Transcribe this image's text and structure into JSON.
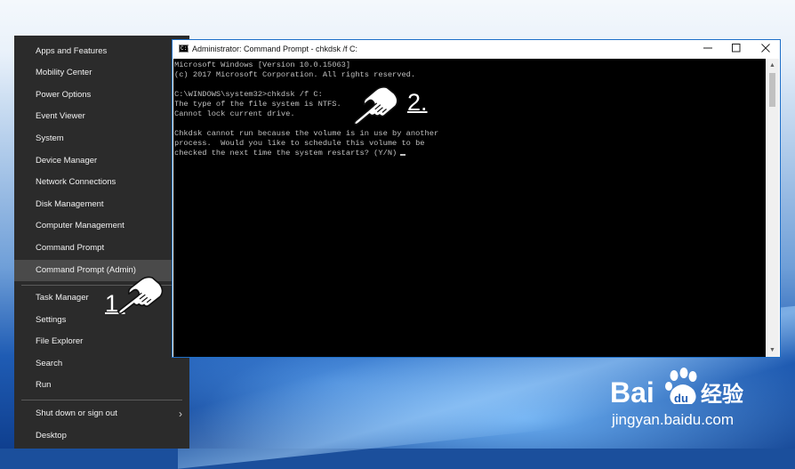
{
  "start_menu": {
    "items": [
      {
        "label": "Apps and Features"
      },
      {
        "label": "Mobility Center"
      },
      {
        "label": "Power Options"
      },
      {
        "label": "Event Viewer"
      },
      {
        "label": "System"
      },
      {
        "label": "Device Manager"
      },
      {
        "label": "Network Connections"
      },
      {
        "label": "Disk Management"
      },
      {
        "label": "Computer Management"
      },
      {
        "label": "Command Prompt"
      },
      {
        "label": "Command Prompt (Admin)"
      },
      {
        "label": "Task Manager"
      },
      {
        "label": "Settings"
      },
      {
        "label": "File Explorer"
      },
      {
        "label": "Search"
      },
      {
        "label": "Run"
      },
      {
        "label": "Shut down or sign out"
      },
      {
        "label": "Desktop"
      }
    ],
    "highlighted": "Command Prompt (Admin)"
  },
  "cmd_window": {
    "icon_text": "C:\\",
    "title": "Administrator: Command Prompt - chkdsk  /f C:",
    "minimize": "—",
    "maximize": "☐",
    "close": "✕",
    "lines": [
      "Microsoft Windows [Version 10.0.15063]",
      "(c) 2017 Microsoft Corporation. All rights reserved.",
      "",
      "C:\\WINDOWS\\system32>chkdsk /f C:",
      "The type of the file system is NTFS.",
      "Cannot lock current drive.",
      "",
      "Chkdsk cannot run because the volume is in use by another",
      "process.  Would you like to schedule this volume to be",
      "checked the next time the system restarts? (Y/N)"
    ]
  },
  "annotations": {
    "step1": "1.",
    "step2": "2."
  },
  "watermark": {
    "brand_latin_1": "Bai",
    "brand_latin_2": "du",
    "brand_cn": "经验",
    "url": "jingyan.baidu.com"
  },
  "colors": {
    "menu_bg": "#2b2b2b",
    "menu_highlight": "#4a4a4a",
    "console_bg": "#000000",
    "console_text": "#c0c0c0",
    "window_border": "#1e6fc8"
  }
}
